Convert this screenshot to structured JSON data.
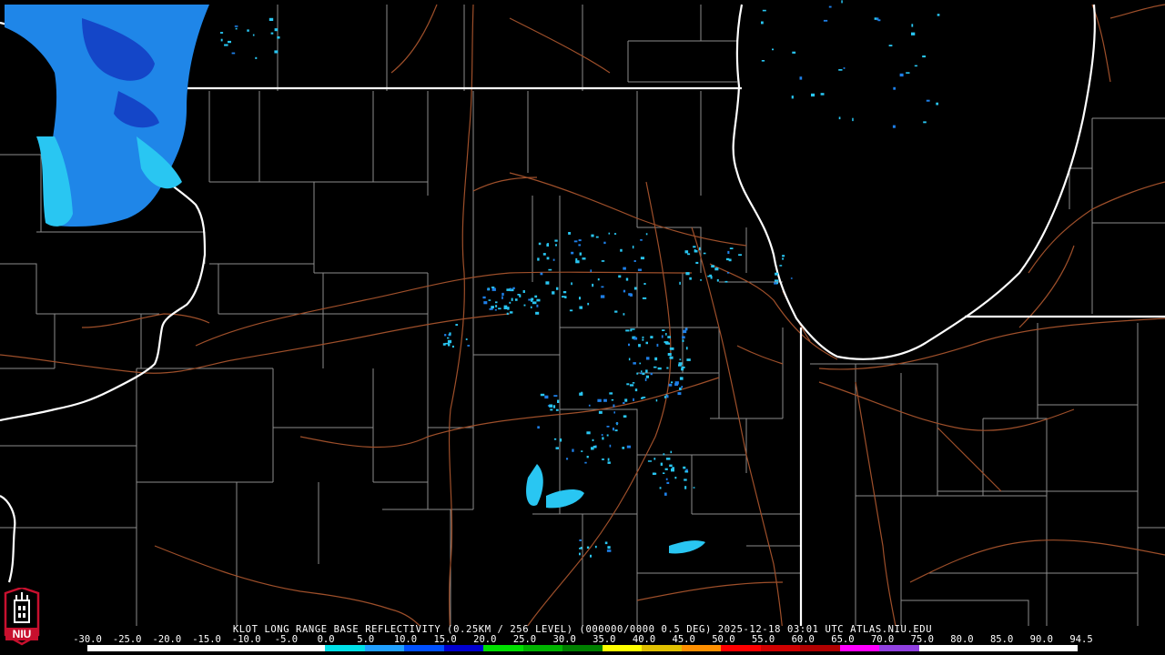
{
  "title": "KLOT LONG RANGE BASE REFLECTIVITY (0.25KM / 256 LEVEL) (000000/0000 0.5 DEG) 2025-12-18 03:01 UTC  ATLAS.NIU.EDU",
  "scale": {
    "labels": [
      "-30.0",
      "-25.0",
      "-20.0",
      "-15.0",
      "-10.0",
      "-5.0",
      "0.0",
      "5.0",
      "10.0",
      "15.0",
      "20.0",
      "25.0",
      "30.0",
      "35.0",
      "40.0",
      "45.0",
      "50.0",
      "55.0",
      "60.0",
      "65.0",
      "70.0",
      "75.0",
      "80.0",
      "85.0",
      "90.0",
      "94.5"
    ],
    "colors": [
      "#ffffff",
      "#ffffff",
      "#ffffff",
      "#ffffff",
      "#ffffff",
      "#ffffff",
      "#00e0e8",
      "#20a0ff",
      "#0050ff",
      "#0000d0",
      "#00e000",
      "#00b400",
      "#008000",
      "#ffff00",
      "#e0c000",
      "#ff9000",
      "#ff0000",
      "#d00000",
      "#b00000",
      "#ff00ff",
      "#9040e0",
      "#ffffff",
      "#ffffff",
      "#ffffff",
      "#ffffff"
    ]
  },
  "colors": {
    "state_line": "#ffffff",
    "county_line": "#9a9a9a",
    "highway": "#a0522d",
    "echo_light": "#29c6f2",
    "echo_mid": "#1e7fe8",
    "echo_dark": "#1446c8"
  },
  "logo": {
    "text": "NIU",
    "icon": "niu-tower-logo",
    "color": "#c8102e"
  }
}
